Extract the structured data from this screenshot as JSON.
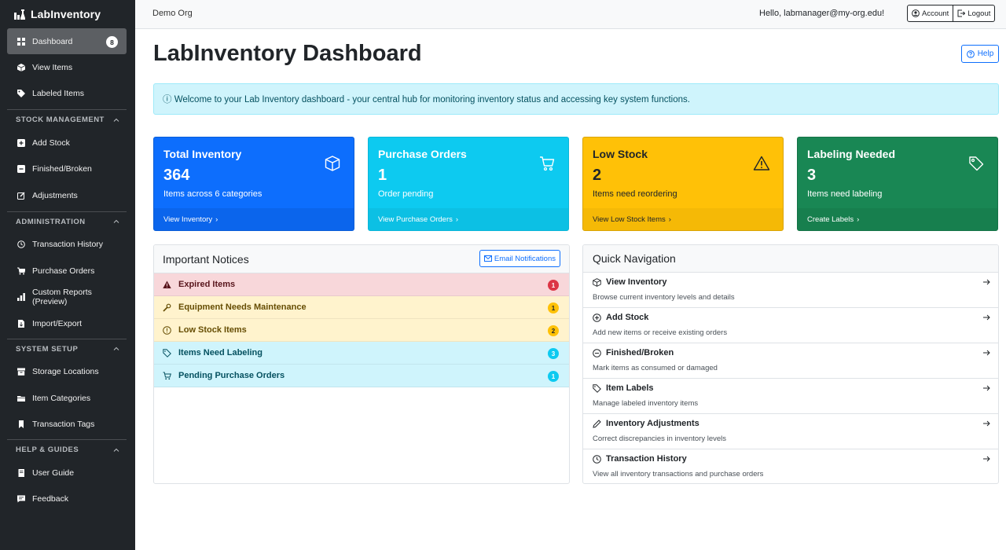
{
  "brand": {
    "name": "LabInventory"
  },
  "sidebar": {
    "items_top": [
      {
        "label": "Dashboard",
        "badge": "8",
        "icon": "grid-icon",
        "active": true
      },
      {
        "label": "View Items",
        "icon": "box-icon"
      },
      {
        "label": "Labeled Items",
        "icon": "tags-icon"
      }
    ],
    "sections": [
      {
        "title": "STOCK MANAGEMENT",
        "items": [
          {
            "label": "Add Stock",
            "icon": "plus-square-icon"
          },
          {
            "label": "Finished/Broken",
            "icon": "minus-square-icon"
          },
          {
            "label": "Adjustments",
            "icon": "pencil-square-icon"
          }
        ]
      },
      {
        "title": "ADMINISTRATION",
        "items": [
          {
            "label": "Transaction History",
            "icon": "clock-icon"
          },
          {
            "label": "Purchase Orders",
            "icon": "cart-icon"
          },
          {
            "label": "Custom Reports (Preview)",
            "icon": "bar-chart-icon"
          },
          {
            "label": "Import/Export",
            "icon": "file-arrow-icon"
          }
        ]
      },
      {
        "title": "SYSTEM SETUP",
        "items": [
          {
            "label": "Storage Locations",
            "icon": "archive-icon"
          },
          {
            "label": "Item Categories",
            "icon": "folder-icon"
          },
          {
            "label": "Transaction Tags",
            "icon": "bookmark-icon"
          }
        ]
      },
      {
        "title": "HELP & GUIDES",
        "items": [
          {
            "label": "User Guide",
            "icon": "book-icon"
          },
          {
            "label": "Feedback",
            "icon": "chat-icon"
          }
        ]
      }
    ]
  },
  "topbar": {
    "org": "Demo Org",
    "greeting": "Hello, labmanager@my-org.edu!",
    "account_label": "Account",
    "logout_label": "Logout"
  },
  "page": {
    "title": "LabInventory Dashboard",
    "help_label": "Help",
    "alert": "ⓘ Welcome to your Lab Inventory dashboard - your central hub for monitoring inventory status and accessing key system functions."
  },
  "cards": [
    {
      "title": "Total Inventory",
      "value": "364",
      "subtitle": "Items across 6 categories",
      "link": "View Inventory",
      "icon": "box-icon",
      "color": "#0d6efd"
    },
    {
      "title": "Purchase Orders",
      "value": "1",
      "subtitle": "Order pending",
      "link": "View Purchase Orders",
      "icon": "cart-icon",
      "color": "#0dcaf0"
    },
    {
      "title": "Low Stock",
      "value": "2",
      "subtitle": "Items need reordering",
      "link": "View Low Stock Items",
      "icon": "warning-icon",
      "color": "#ffc107"
    },
    {
      "title": "Labeling Needed",
      "value": "3",
      "subtitle": "Items need labeling",
      "link": "Create Labels",
      "icon": "tag-icon",
      "color": "#198754"
    }
  ],
  "notices": {
    "title": "Important Notices",
    "email_label": "Email Notifications",
    "items": [
      {
        "label": "Expired Items",
        "count": "1",
        "icon": "warning-fill-icon",
        "color": "#dc3545"
      },
      {
        "label": "Equipment Needs Maintenance",
        "count": "1",
        "icon": "wrench-icon",
        "color": "#ffc107"
      },
      {
        "label": "Low Stock Items",
        "count": "2",
        "icon": "exclamation-circle-icon",
        "color": "#ffc107"
      },
      {
        "label": "Items Need Labeling",
        "count": "3",
        "icon": "tag-icon",
        "color": "#0dcaf0"
      },
      {
        "label": "Pending Purchase Orders",
        "count": "1",
        "icon": "cart-icon",
        "color": "#0dcaf0"
      }
    ]
  },
  "quicknav": {
    "title": "Quick Navigation",
    "items": [
      {
        "title": "View Inventory",
        "desc": "Browse current inventory levels and details",
        "icon": "box-icon"
      },
      {
        "title": "Add Stock",
        "desc": "Add new items or receive existing orders",
        "icon": "plus-circle-icon"
      },
      {
        "title": "Finished/Broken",
        "desc": "Mark items as consumed or damaged",
        "icon": "minus-circle-icon"
      },
      {
        "title": "Item Labels",
        "desc": "Manage labeled inventory items",
        "icon": "tag-icon"
      },
      {
        "title": "Inventory Adjustments",
        "desc": "Correct discrepancies in inventory levels",
        "icon": "pencil-icon"
      },
      {
        "title": "Transaction History",
        "desc": "View all inventory transactions and purchase orders",
        "icon": "clock-icon"
      }
    ]
  }
}
